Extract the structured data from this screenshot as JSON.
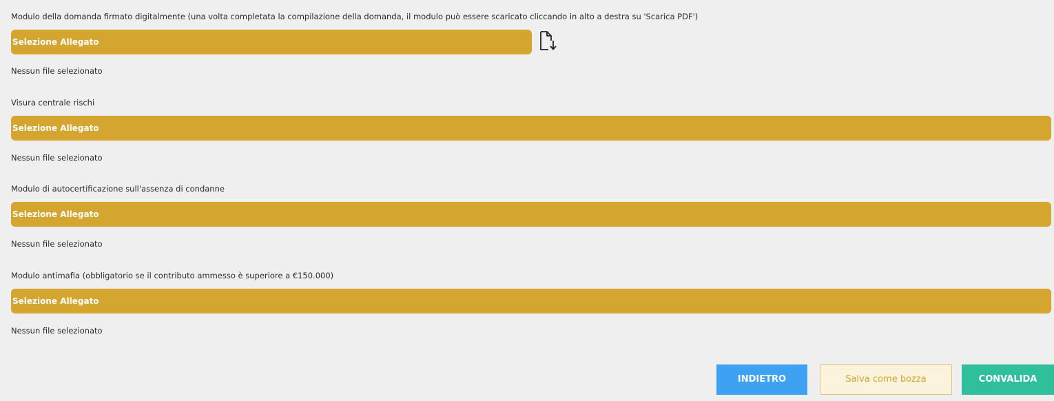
{
  "attachments": [
    {
      "label": "Modulo della domanda firmato digitalmente (una volta completata la compilazione della domanda, il modulo può essere scaricato cliccando in alto a destra su 'Scarica PDF')",
      "button": "Selezione Allegato",
      "status": "Nessun file selezionato",
      "has_download": true
    },
    {
      "label": "Visura centrale rischi",
      "button": "Selezione Allegato",
      "status": "Nessun file selezionato"
    },
    {
      "label": "Modulo di autocertificazione sull'assenza di condanne",
      "button": "Selezione Allegato",
      "status": "Nessun file selezionato"
    },
    {
      "label": "Modulo antimafia (obbligatorio se il contributo ammesso è superiore a €150.000)",
      "button": "Selezione Allegato",
      "status": "Nessun file selezionato"
    }
  ],
  "actions": {
    "back": "INDIETRO",
    "save_draft": "Salva come bozza",
    "validate": "CONVALIDA"
  },
  "colors": {
    "upload_bar": "#d4a62f",
    "back": "#3ea1f2",
    "validate": "#2fbf9b",
    "draft_bg": "#fcf3dc"
  },
  "icons": {
    "download": "file-download-icon"
  }
}
